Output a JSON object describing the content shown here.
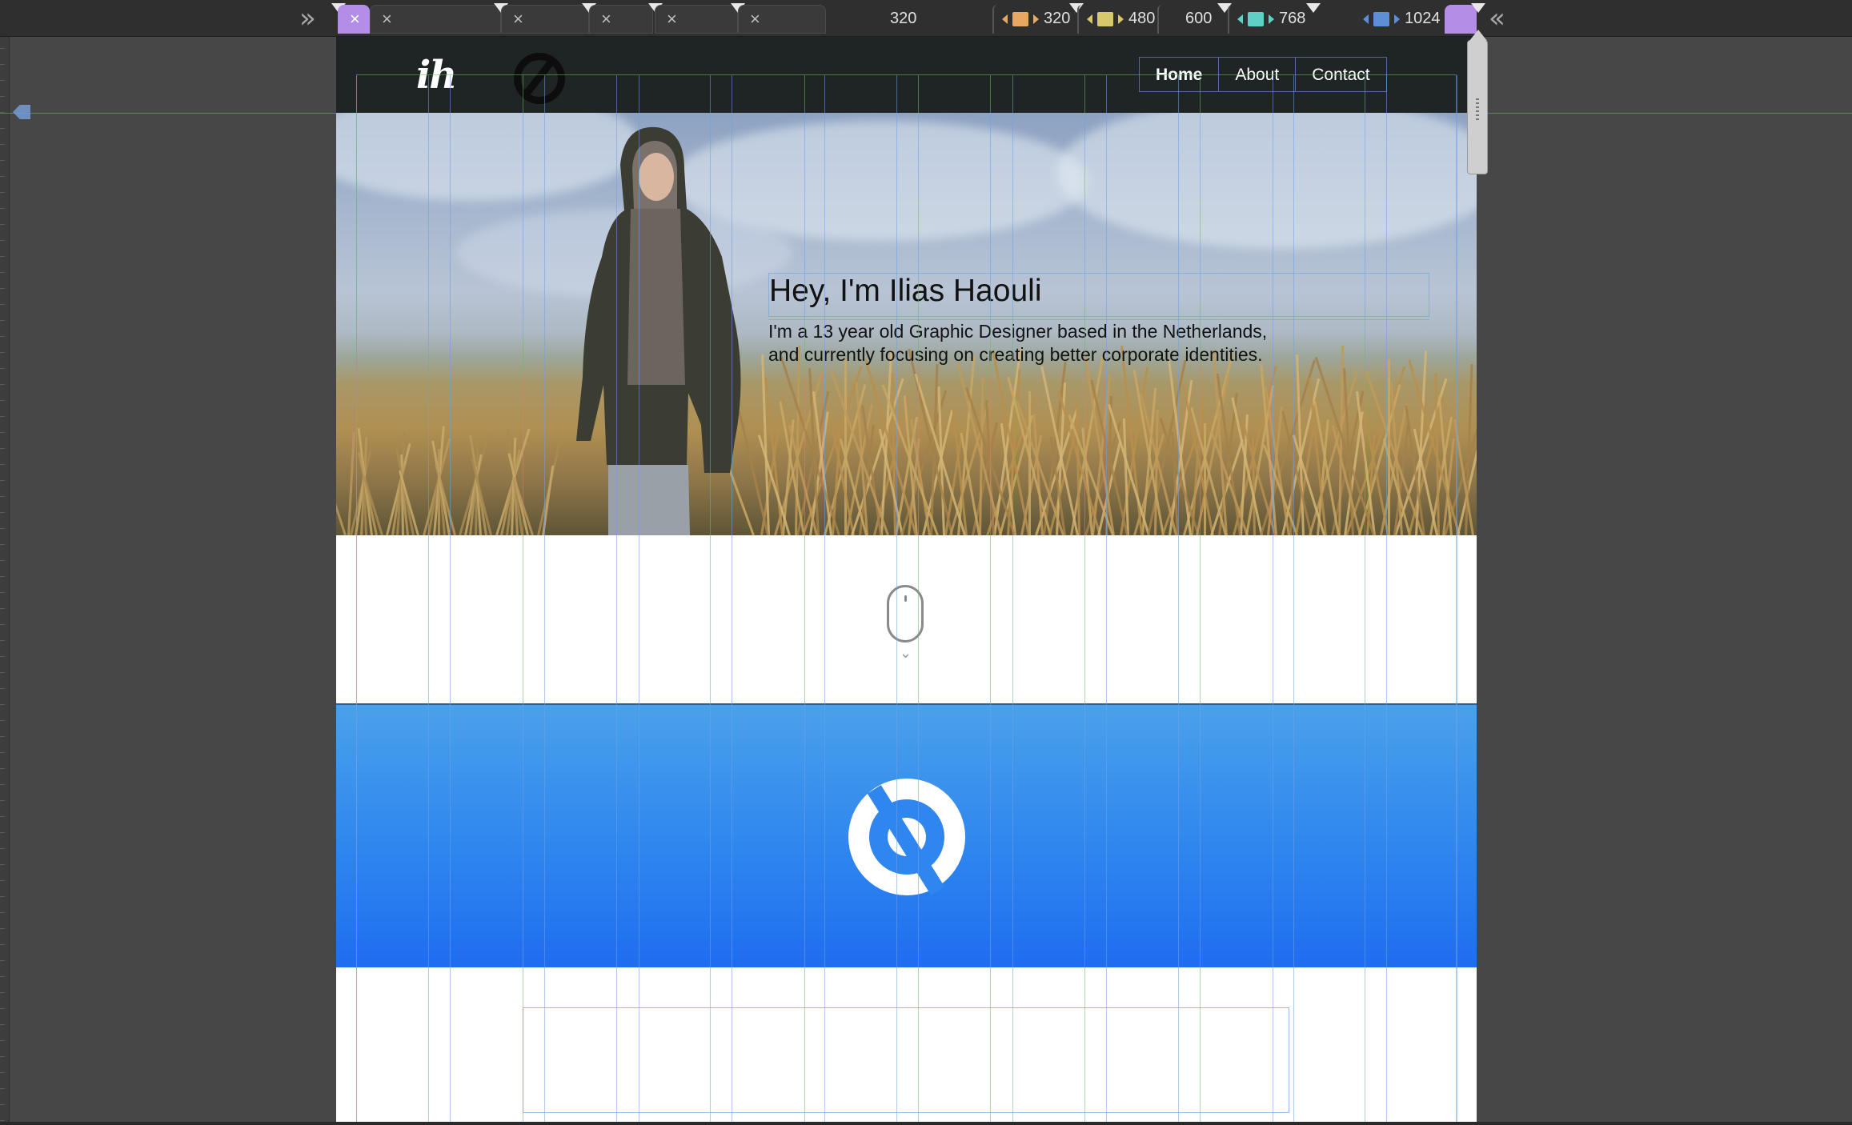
{
  "toolbar": {
    "left_chevron": "»",
    "right_chevron": "«",
    "close_glyph": "×",
    "breakpoints": [
      {
        "label": "320",
        "color": ""
      },
      {
        "label": "320",
        "color": "#e8a863"
      },
      {
        "label": "480",
        "color": "#d8c86a"
      },
      {
        "label": "600",
        "color": ""
      },
      {
        "label": "768",
        "color": "#5fd0c6"
      },
      {
        "label": "1024",
        "color": "#5b8fd6"
      }
    ]
  },
  "site": {
    "logo_text": "ih",
    "nav": {
      "home": "Home",
      "about": "About",
      "contact": "Contact"
    },
    "hero": {
      "title": "Hey, I'm Ilias Haouli",
      "subtitle_line1": "I'm a 13 year old Graphic Designer based in the Netherlands,",
      "subtitle_line2": "and currently focusing on creating better corporate identities."
    },
    "scroll_hint": "⌄"
  },
  "colors": {
    "header_bg": "#1f2425",
    "blue_top": "#4aa1ea",
    "blue_bottom": "#1f6df0",
    "accent_purple": "#b48ee6",
    "grid": "#6ea0e6"
  }
}
